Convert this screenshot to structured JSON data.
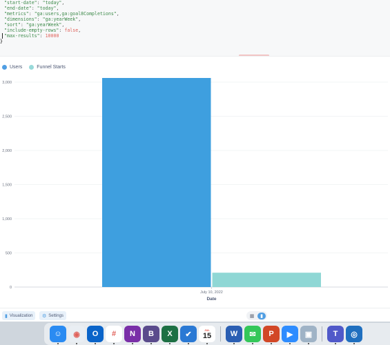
{
  "editor": {
    "lines": [
      {
        "key": "\"start-date\"",
        "sep": ": ",
        "val": "\"today\"",
        "tail": ",",
        "kind": "s"
      },
      {
        "key": "\"end-date\"",
        "sep": ": ",
        "val": "\"today\"",
        "tail": ",",
        "kind": "s"
      },
      {
        "key": "\"metrics\"",
        "sep": ": ",
        "val": "\"ga:users,ga:goal8Completions\"",
        "tail": ",",
        "kind": "s"
      },
      {
        "key": "\"dimensions\"",
        "sep": ": ",
        "val": "\"ga:yearWeek\"",
        "tail": ",",
        "kind": "s"
      },
      {
        "key": "\"sort\"",
        "sep": ": ",
        "val": "\"ga:yearWeek\"",
        "tail": ",",
        "kind": "s"
      },
      {
        "key": "\"include-empty-rows\"",
        "sep": ": ",
        "val": "false",
        "tail": ",",
        "kind": "b"
      },
      {
        "key": "\"max-results\"",
        "sep": ": ",
        "val": "10000",
        "tail": "",
        "kind": "n"
      }
    ],
    "closing": "}"
  },
  "legend": [
    {
      "label": "Users",
      "color": "#509ee3"
    },
    {
      "label": "Funnel Starts",
      "color": "#98d9d9"
    }
  ],
  "chart_data": {
    "type": "bar",
    "categories": [
      "July 10, 2022"
    ],
    "series": [
      {
        "name": "Users",
        "values": [
          3090
        ],
        "color": "#3e9fdf"
      },
      {
        "name": "Funnel Starts",
        "values": [
          210
        ],
        "color": "#8fd7d5"
      }
    ],
    "xlabel": "Date",
    "ylabel": "",
    "ylim": [
      0,
      3000
    ],
    "yticks": [
      0,
      500,
      1000,
      1500,
      2000,
      2500,
      3000
    ],
    "ytick_labels": [
      "0",
      "500",
      "1,000",
      "1,500",
      "2,000",
      "2,500",
      "3,000"
    ],
    "grid": true,
    "legend": "top-left"
  },
  "bottombar": {
    "visualization_label": "Visualization",
    "settings_label": "Settings",
    "table_icon": "table-icon",
    "chart_icon": "bar-chart-icon"
  },
  "dock": {
    "calendar_month": "JUL",
    "calendar_day": "15",
    "apps": [
      {
        "name": "finder-icon",
        "glyph": "☺",
        "bg": "#2a8bf2"
      },
      {
        "name": "chrome-icon",
        "glyph": "◉",
        "bg": "#e9eef3"
      },
      {
        "name": "outlook-icon",
        "glyph": "O",
        "bg": "#0a64c9"
      },
      {
        "name": "slack-icon",
        "glyph": "#",
        "bg": "#ffffff"
      },
      {
        "name": "onenote-icon",
        "glyph": "N",
        "bg": "#7a2fa8"
      },
      {
        "name": "bbedit-icon",
        "glyph": "B",
        "bg": "#5a4b8c"
      },
      {
        "name": "excel-icon",
        "glyph": "X",
        "bg": "#1d7044"
      },
      {
        "name": "things-icon",
        "glyph": "✔",
        "bg": "#2a79d4"
      },
      {
        "name": "calendar-icon",
        "glyph": "",
        "bg": "#ffffff"
      },
      {
        "name": "word-icon",
        "glyph": "W",
        "bg": "#2b5fb3"
      },
      {
        "name": "messages-icon",
        "glyph": "✉",
        "bg": "#34c759"
      },
      {
        "name": "powerpoint-icon",
        "glyph": "P",
        "bg": "#d24726"
      },
      {
        "name": "zoom-icon",
        "glyph": "▶",
        "bg": "#2d8cff"
      },
      {
        "name": "preview-icon",
        "glyph": "▣",
        "bg": "#9fb3c6"
      },
      {
        "name": "teams-icon",
        "glyph": "T",
        "bg": "#5059c9"
      },
      {
        "name": "app-icon",
        "glyph": "◎",
        "bg": "#1f6fbf"
      }
    ]
  }
}
